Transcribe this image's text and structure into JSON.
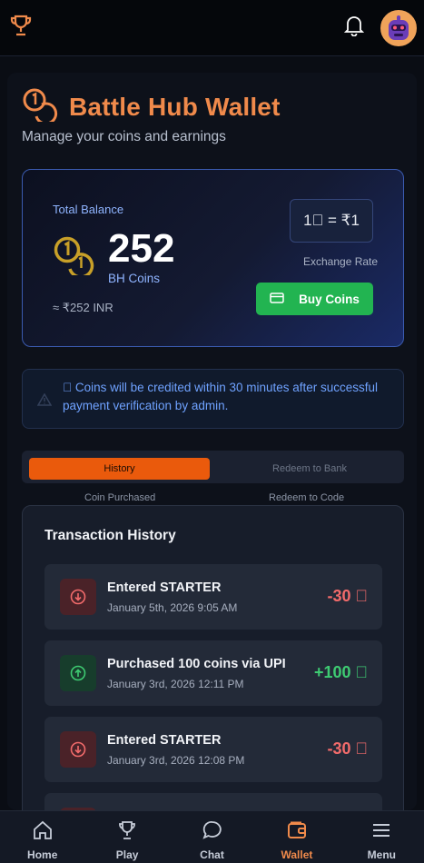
{
  "header": {
    "logo_icon": "trophy-icon",
    "notification_icon": "bell-icon",
    "avatar_icon": "robot-avatar"
  },
  "page": {
    "title": "Battle Hub Wallet",
    "subtitle": "Manage your coins and earnings"
  },
  "balance": {
    "label": "Total Balance",
    "amount": "252",
    "unit": "BH Coins",
    "inr": "≈ ₹252 INR",
    "rate": "1\u0000 = ₹1",
    "rate_label": "Exchange Rate",
    "buy_label": "Buy Coins"
  },
  "notice": {
    "text": "\u0000 Coins will be credited within 30 minutes after successful payment verification by admin."
  },
  "tabs": {
    "active": "History",
    "inactive": "Redeem to Bank",
    "sub_left": "Coin Purchased",
    "sub_right": "Redeem to Code"
  },
  "history": {
    "title": "Transaction History",
    "items": [
      {
        "title": "Entered STARTER",
        "date": "January 5th, 2026 9:05 AM",
        "amount": "-30 \u0000",
        "kind": "debit"
      },
      {
        "title": "Purchased 100 coins via UPI",
        "date": "January 3rd, 2026 12:11 PM",
        "amount": "+100 \u0000",
        "kind": "credit"
      },
      {
        "title": "Entered STARTER",
        "date": "January 3rd, 2026 12:08 PM",
        "amount": "-30 \u0000",
        "kind": "debit"
      }
    ]
  },
  "nav": {
    "items": [
      {
        "label": "Home",
        "icon": "home-icon"
      },
      {
        "label": "Play",
        "icon": "trophy-icon"
      },
      {
        "label": "Chat",
        "icon": "chat-icon"
      },
      {
        "label": "Wallet",
        "icon": "wallet-icon"
      },
      {
        "label": "Menu",
        "icon": "menu-icon"
      }
    ],
    "active": "Wallet"
  },
  "colors": {
    "accent": "#f08a4b",
    "active_tab": "#ea5a0c",
    "buy_button": "#22b451",
    "debit": "#f26b6b",
    "credit": "#3ecb72",
    "info": "#6fa2ff"
  }
}
